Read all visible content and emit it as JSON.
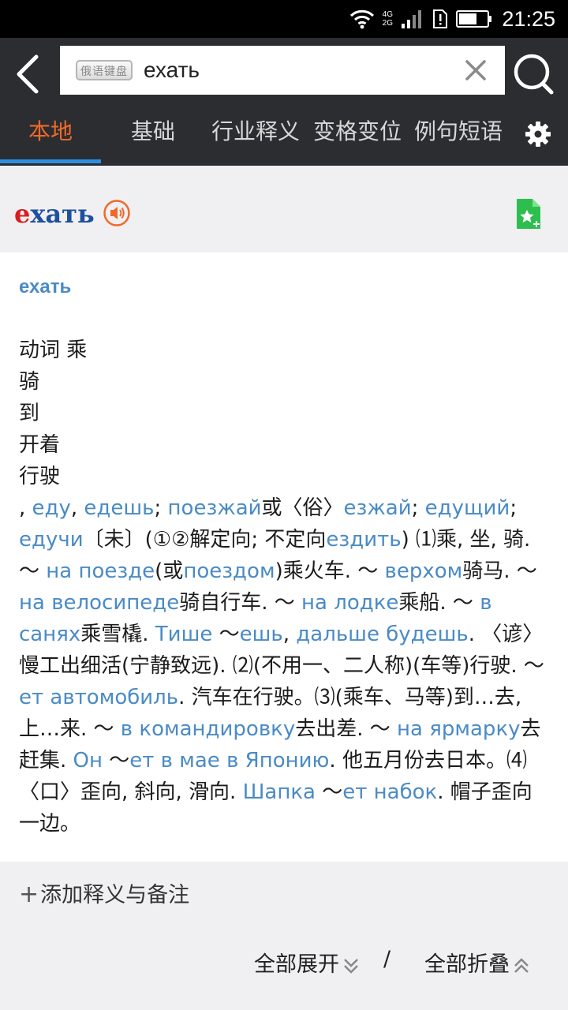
{
  "status": {
    "time": "21:25",
    "net_top": "4G",
    "net_bottom": "2G"
  },
  "search": {
    "keyboard_label": "俄语键盘",
    "query": "ехать"
  },
  "tabs": [
    "本地",
    "基础",
    "行业释义",
    "变格变位",
    "例句短语"
  ],
  "headword": {
    "first": "е",
    "rest": "хать"
  },
  "entry": {
    "word": "ехать",
    "lines": [
      "动词 乘",
      "骑",
      "到",
      "开着",
      "行驶"
    ],
    "body": [
      {
        "t": ", "
      },
      {
        "l": "еду"
      },
      {
        "t": ", "
      },
      {
        "l": "едешь"
      },
      {
        "t": "; "
      },
      {
        "l": "поезжай"
      },
      {
        "t": "或〈俗〉"
      },
      {
        "l": "езжай"
      },
      {
        "t": "; "
      },
      {
        "l": "едущий"
      },
      {
        "t": "; "
      },
      {
        "l": "едучи"
      },
      {
        "t": "〔未〕(①②解定向; 不定向"
      },
      {
        "l": "ездить"
      },
      {
        "t": ") ⑴乘, 坐, 骑. ～ "
      },
      {
        "l": "на поезде"
      },
      {
        "t": "(或"
      },
      {
        "l": "поездом"
      },
      {
        "t": ")乘火车. ～ "
      },
      {
        "l": "верхом"
      },
      {
        "t": "骑马. ～ "
      },
      {
        "l": "на велосипеде"
      },
      {
        "t": "骑自行车. ～ "
      },
      {
        "l": "на лодке"
      },
      {
        "t": "乘船. ～ "
      },
      {
        "l": "в санях"
      },
      {
        "t": "乘雪橇. "
      },
      {
        "l": "Тише"
      },
      {
        "t": " ～"
      },
      {
        "l": "ешь"
      },
      {
        "t": ", "
      },
      {
        "l": "дальше будешь"
      },
      {
        "t": ". 〈谚〉慢工出细活(宁静致远). ⑵(不用一、二人称)(车等)行驶. ～"
      },
      {
        "l": "ет автомобиль"
      },
      {
        "t": ". 汽车在行驶。⑶(乘车、马等)到…去, 上…来. ～ "
      },
      {
        "l": "в командировку"
      },
      {
        "t": "去出差. ～ "
      },
      {
        "l": "на ярмарку"
      },
      {
        "t": "去赶集. "
      },
      {
        "l": "Он"
      },
      {
        "t": " ～"
      },
      {
        "l": "ет в мае в Японию"
      },
      {
        "t": ". 他五月份去日本。⑷〈口〉歪向, 斜向, 滑向. "
      },
      {
        "l": "Шапка"
      },
      {
        "t": " ～"
      },
      {
        "l": "ет набок"
      },
      {
        "t": ". 帽子歪向一边。"
      }
    ]
  },
  "actions": {
    "add_note": "添加释义与备注",
    "expand_all": "全部展开",
    "separator": "/",
    "collapse_all": "全部折叠"
  },
  "colors": {
    "accent_orange": "#f0692a",
    "link_blue": "#4a8bc6",
    "tab_underline": "#2b8fe0",
    "topbar": "#2b2d31"
  }
}
